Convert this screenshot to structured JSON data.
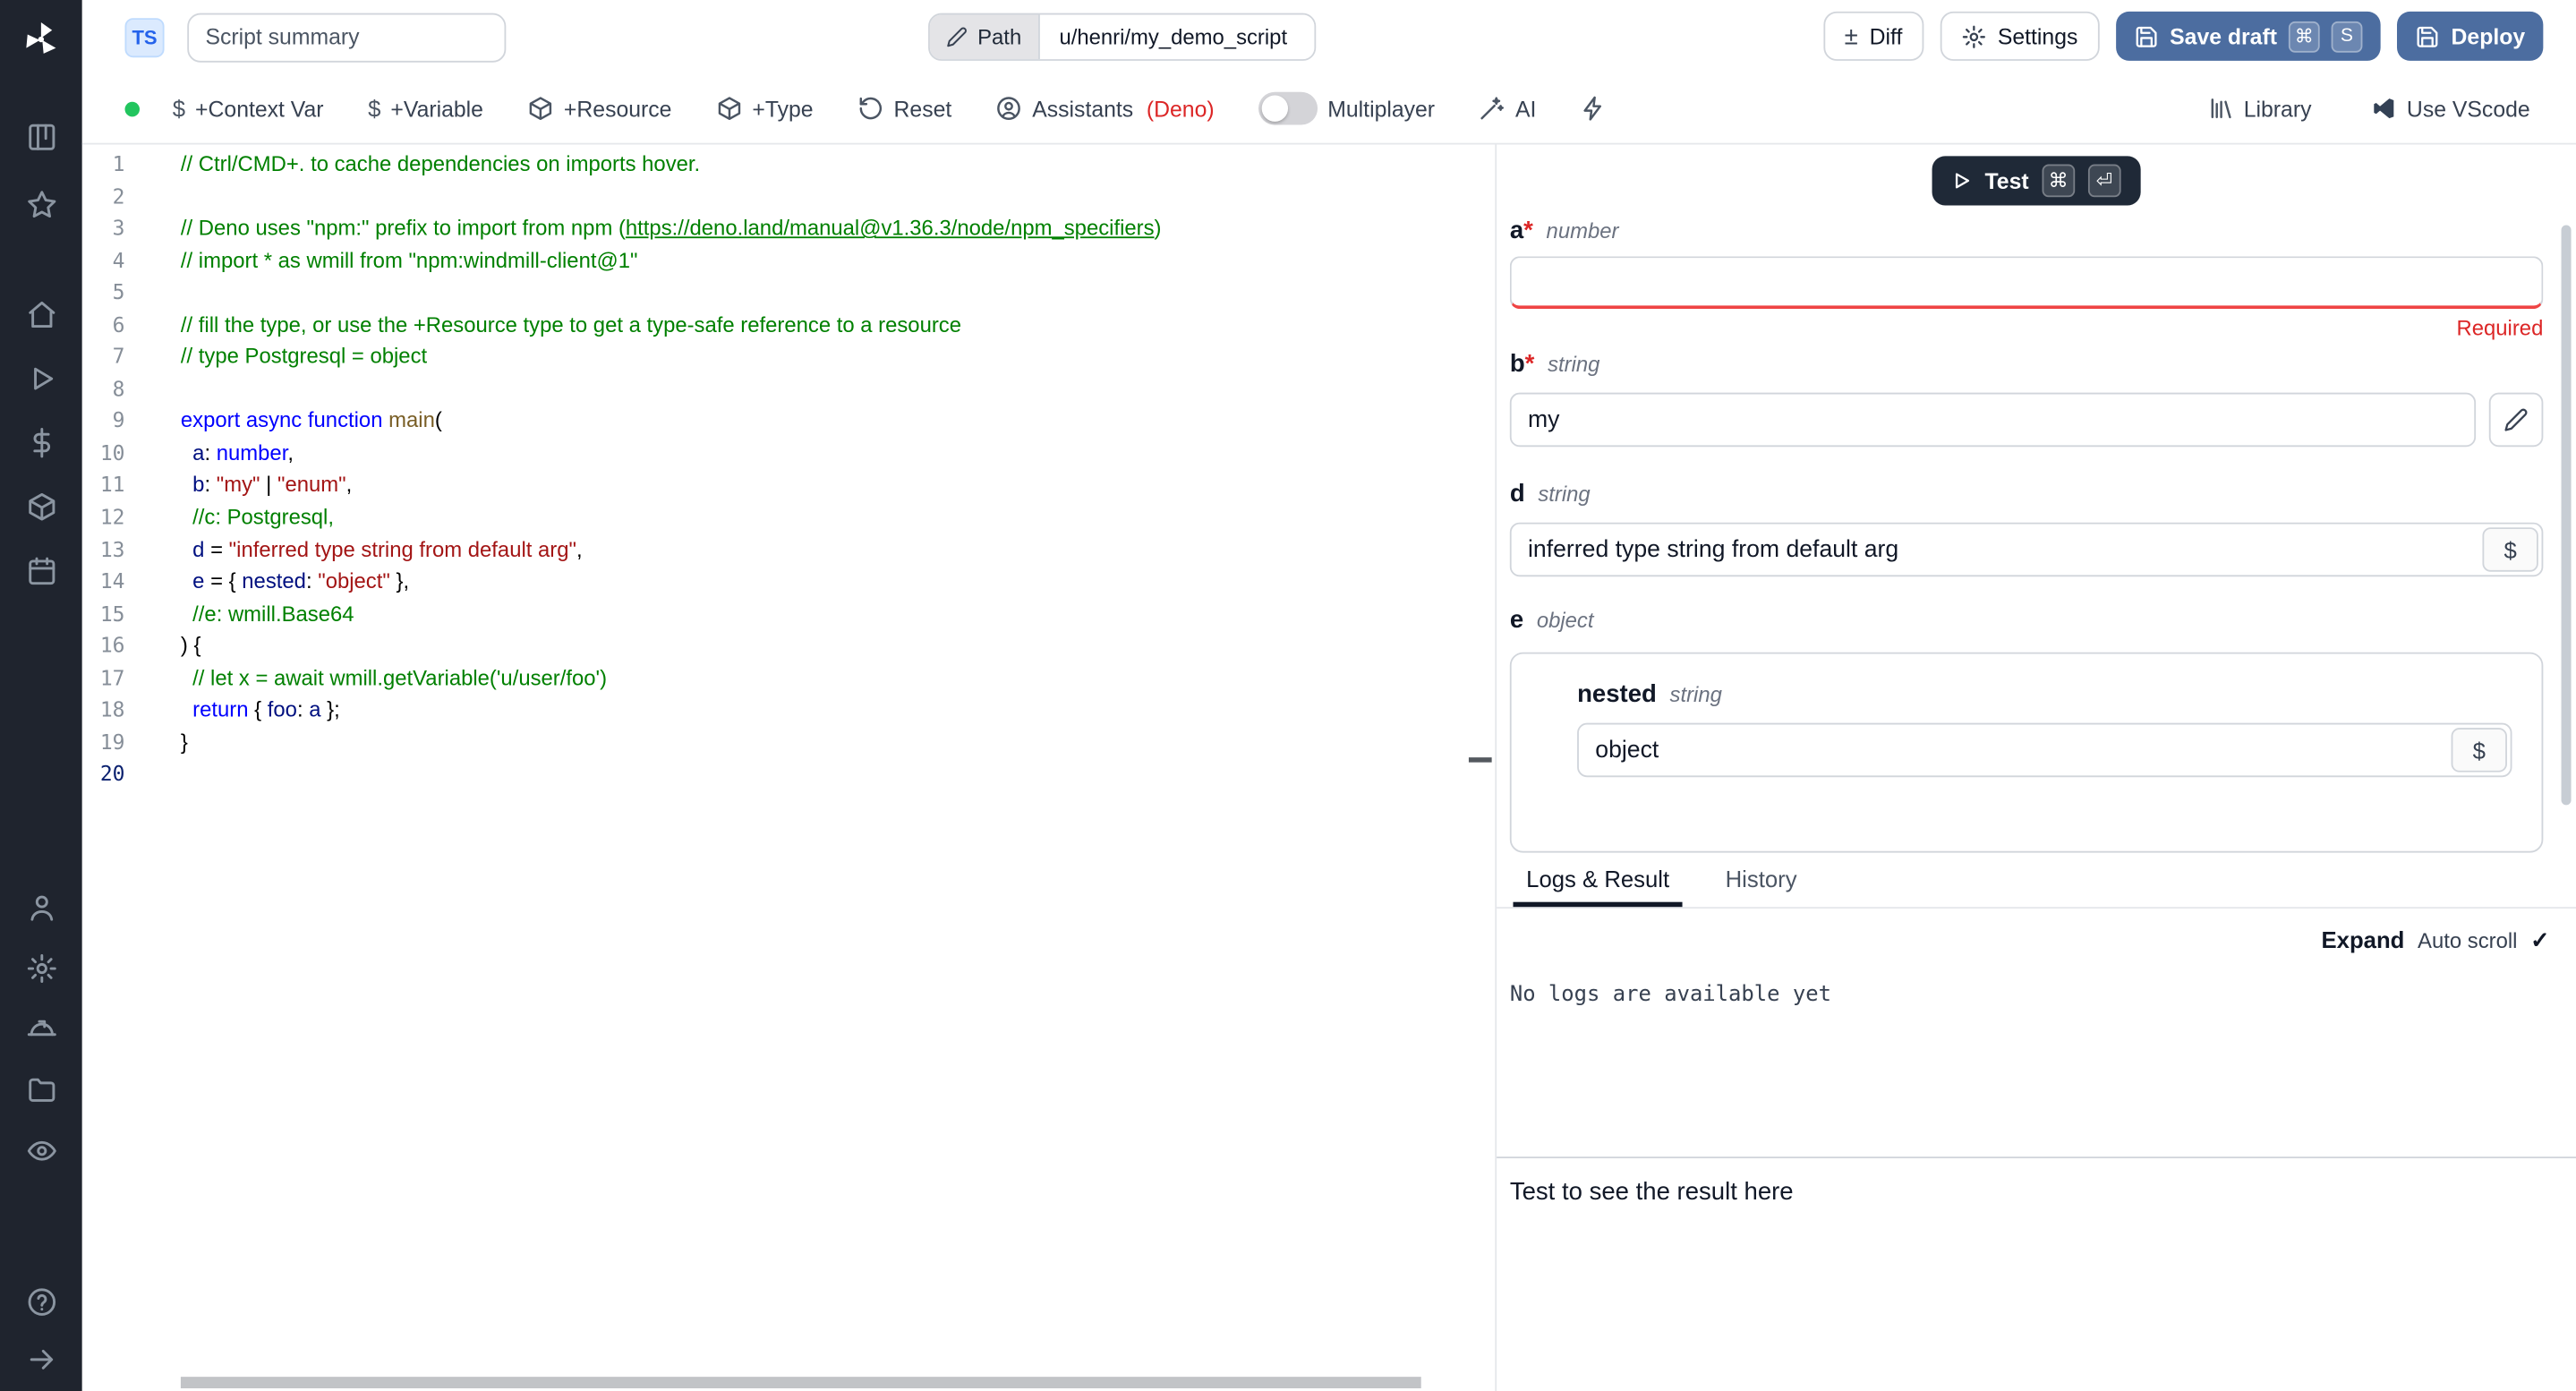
{
  "colors": {
    "primary": "#4c6da0",
    "sidebar": "#1f242e",
    "accent-green": "#22c55e",
    "danger": "#dc2626",
    "tab-active": "#111827"
  },
  "header": {
    "lang_badge": "TS",
    "summary_placeholder": "Script summary",
    "path_label": "Path",
    "path_value": "u/henri/my_demo_script",
    "plusminus": "±",
    "diff": "Diff",
    "settings": "Settings",
    "save_draft": "Save draft",
    "cmd_key": "⌘",
    "s_key": "S",
    "deploy": "Deploy"
  },
  "toolbar": {
    "dollar": "$",
    "context_var": "+Context Var",
    "variable": "+Variable",
    "resource": "+Resource",
    "type": "+Type",
    "reset": "Reset",
    "assistants": "Assistants",
    "assistants_lang": "(Deno)",
    "multiplayer": "Multiplayer",
    "ai": "AI",
    "library": "Library",
    "vscode": "Use VScode"
  },
  "editor": {
    "active_line": 20,
    "lines": [
      [
        [
          "cmt",
          "// Ctrl/CMD+. to cache dependencies on imports hover."
        ]
      ],
      [],
      [
        [
          "cmt",
          "// Deno uses \"npm:\" prefix to import from npm ("
        ],
        [
          "lnk",
          "https://deno.land/manual@v1.36.3/node/npm_specifiers"
        ],
        [
          "cmt",
          ")"
        ]
      ],
      [
        [
          "cmt",
          "// import * as wmill from \"npm:windmill-client@1\""
        ]
      ],
      [],
      [
        [
          "cmt",
          "// fill the type, or use the +Resource type to get a type-safe reference to a resource"
        ]
      ],
      [
        [
          "cmt",
          "// type Postgresql = object"
        ]
      ],
      [],
      [
        [
          "kw",
          "export"
        ],
        [
          "pl",
          " "
        ],
        [
          "kw",
          "async"
        ],
        [
          "pl",
          " "
        ],
        [
          "kw",
          "function"
        ],
        [
          "pl",
          " "
        ],
        [
          "fn",
          "main"
        ],
        [
          "pl",
          "("
        ]
      ],
      [
        [
          "pl",
          "  "
        ],
        [
          "var",
          "a"
        ],
        [
          "pl",
          ": "
        ],
        [
          "kw",
          "number"
        ],
        [
          "pl",
          ","
        ]
      ],
      [
        [
          "pl",
          "  "
        ],
        [
          "var",
          "b"
        ],
        [
          "pl",
          ": "
        ],
        [
          "str",
          "\"my\""
        ],
        [
          "pl",
          " | "
        ],
        [
          "str",
          "\"enum\""
        ],
        [
          "pl",
          ","
        ]
      ],
      [
        [
          "cmt",
          "  //c: Postgresql,"
        ]
      ],
      [
        [
          "pl",
          "  "
        ],
        [
          "var",
          "d"
        ],
        [
          "pl",
          " = "
        ],
        [
          "str",
          "\"inferred type string from default arg\""
        ],
        [
          "pl",
          ","
        ]
      ],
      [
        [
          "pl",
          "  "
        ],
        [
          "var",
          "e"
        ],
        [
          "pl",
          " = { "
        ],
        [
          "var",
          "nested"
        ],
        [
          "pl",
          ": "
        ],
        [
          "str",
          "\"object\""
        ],
        [
          "pl",
          " },"
        ]
      ],
      [
        [
          "cmt",
          "  //e: wmill.Base64"
        ]
      ],
      [
        [
          "pl",
          ") {"
        ]
      ],
      [
        [
          "cmt",
          "  // let x = await wmill.getVariable('u/user/foo')"
        ]
      ],
      [
        [
          "pl",
          "  "
        ],
        [
          "kw",
          "return"
        ],
        [
          "pl",
          " { "
        ],
        [
          "var",
          "foo"
        ],
        [
          "pl",
          ": "
        ],
        [
          "var",
          "a"
        ],
        [
          "pl",
          " };"
        ]
      ],
      [
        [
          "pl",
          "}"
        ]
      ],
      []
    ]
  },
  "runner": {
    "test": "Test",
    "cmd_key": "⌘",
    "enter_key": "⏎"
  },
  "form": {
    "required_mark": "*",
    "dollar": "$",
    "a": {
      "name": "a",
      "type": "number",
      "value": "",
      "error": "Required"
    },
    "b": {
      "name": "b",
      "type": "string",
      "value": "my"
    },
    "d": {
      "name": "d",
      "type": "string",
      "value": "inferred type string from default arg"
    },
    "e": {
      "name": "e",
      "type": "object",
      "nested": {
        "name": "nested",
        "type": "string",
        "value": "object"
      }
    }
  },
  "tabs": {
    "logs": "Logs & Result",
    "history": "History"
  },
  "logs": {
    "expand": "Expand",
    "autoscroll": "Auto scroll",
    "check": "✓",
    "empty": "No logs are available yet"
  },
  "result": {
    "placeholder": "Test to see the result here"
  }
}
